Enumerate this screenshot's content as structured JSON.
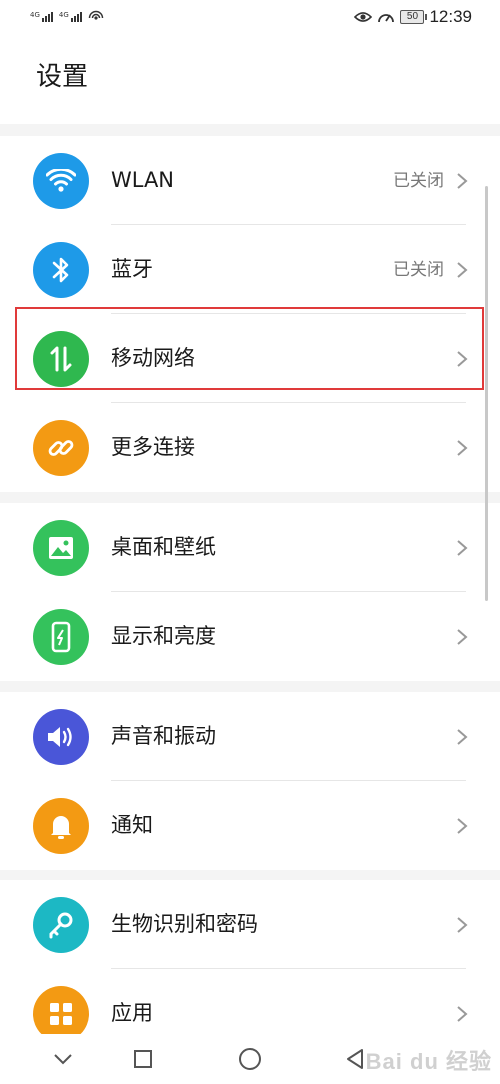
{
  "status_bar": {
    "signal_1_tag": "4G",
    "signal_2_tag": "4G",
    "battery_level": "50",
    "time": "12:39",
    "icons": [
      "signal-icon",
      "signal-icon",
      "hotspot-icon",
      "eye-icon",
      "speed-icon",
      "battery-icon"
    ]
  },
  "header": {
    "title": "设置"
  },
  "groups": [
    {
      "items": [
        {
          "label": "WLAN",
          "value": "已关闭",
          "icon": "wifi-icon",
          "color": "#1e9ae8"
        },
        {
          "label": "蓝牙",
          "value": "已关闭",
          "icon": "bluetooth-icon",
          "color": "#1e9ae8"
        },
        {
          "label": "移动网络",
          "value": "",
          "icon": "mobile-data-icon",
          "color": "#2fb84f",
          "highlighted": true
        },
        {
          "label": "更多连接",
          "value": "",
          "icon": "link-icon",
          "color": "#f39a13"
        }
      ]
    },
    {
      "items": [
        {
          "label": "桌面和壁纸",
          "value": "",
          "icon": "wallpaper-icon",
          "color": "#34c25c"
        },
        {
          "label": "显示和亮度",
          "value": "",
          "icon": "display-icon",
          "color": "#34c25c"
        }
      ]
    },
    {
      "items": [
        {
          "label": "声音和振动",
          "value": "",
          "icon": "sound-icon",
          "color": "#4a56d8"
        },
        {
          "label": "通知",
          "value": "",
          "icon": "bell-icon",
          "color": "#f39a13"
        }
      ]
    },
    {
      "items": [
        {
          "label": "生物识别和密码",
          "value": "",
          "icon": "key-icon",
          "color": "#1cb8c4"
        },
        {
          "label": "应用",
          "value": "",
          "icon": "apps-icon",
          "color": "#f39a13"
        }
      ]
    }
  ],
  "nav_bar": {
    "icons": [
      "chevron-down-icon",
      "recents-icon",
      "home-icon",
      "back-icon"
    ]
  },
  "watermark": "Bai du 经验",
  "colors": {
    "highlight_border": "#e03a3a",
    "background": "#f4f4f4"
  }
}
